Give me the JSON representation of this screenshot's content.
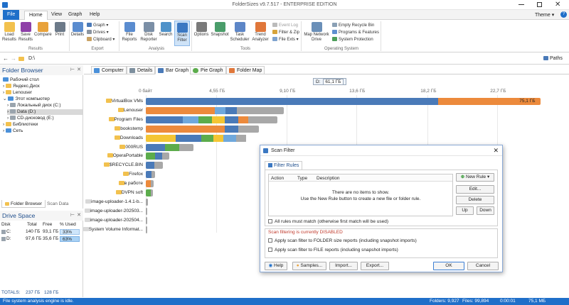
{
  "window": {
    "title": "FolderSizes v9.7.517 - ENTERPRISE EDITION",
    "theme_label": "Theme"
  },
  "ribbon_tabs": [
    "File",
    "Home",
    "View",
    "Graph",
    "Help"
  ],
  "ribbon": {
    "load": "Load Results",
    "save": "Save Results",
    "compare": "Compare",
    "print": "Print",
    "details": "Details",
    "graph": "Graph",
    "drives": "Drives",
    "clipboard": "Clipboard",
    "file_reports": "File Reports",
    "disk_reporter": "Disk Reporter",
    "search": "Search",
    "scan_filter": "Scan Filter",
    "options": "Options",
    "snapshot": "Snapshot",
    "task_scheduler": "Task Scheduler",
    "trend_analyzer": "Trend Analyzer",
    "event_log": "Event Log",
    "filter_zip": "Filter & Zip",
    "file_exts": "File Exts",
    "map_network_drive": "Map Network Drive",
    "empty_recycle_bin": "Empty Recycle Bin",
    "programs_features": "Programs & Features",
    "system_protection": "System Protection",
    "groups": {
      "results": "Results",
      "export": "Export",
      "analysis": "Analysis",
      "tools": "Tools",
      "os": "Operating System"
    }
  },
  "address": {
    "path": "D:\\",
    "paths_label": "Paths"
  },
  "folder_browser": {
    "title": "Folder Browser",
    "items": [
      "Рабочий стол",
      "Яндекс.Диск",
      "Lenouser",
      "Этот компьютер",
      "Локальный диск (C:)",
      "Data (D:)",
      "CD-дисковод (E:)",
      "Библиотеки",
      "Сеть"
    ],
    "tabs": [
      "Folder Browser",
      "Scan Data"
    ]
  },
  "drive_space": {
    "title": "Drive Space",
    "headers": [
      "Disk",
      "Total",
      "Free",
      "% Used"
    ],
    "rows": [
      [
        "C:",
        "140 ГБ",
        "93,1 ГБ",
        "33%"
      ],
      [
        "D:",
        "97,6 ГБ",
        "35,6 ГБ",
        "63%"
      ]
    ],
    "totals": [
      "TOTALS:",
      "237 ГБ",
      "128 ГБ"
    ]
  },
  "content_tabs": [
    "Computer",
    "Details",
    "Bar Graph",
    "Pie Graph",
    "Folder Map"
  ],
  "graph_header": {
    "drive": "D:",
    "size": "61,1 ГБ"
  },
  "chart_data": {
    "type": "bar",
    "orientation": "horizontal",
    "stacked": true,
    "x_ticks": [
      "0 байт",
      "4,55 ГБ",
      "9,10 ГБ",
      "13,6 ГБ",
      "18,2 ГБ",
      "22,7 ГБ"
    ],
    "xlim": [
      0,
      26.5
    ],
    "categories": [
      "VirtualBox VMs",
      "Lenouser",
      "Program Files",
      "bookstemp",
      "Downloads",
      "000RUS",
      "OperaPortable",
      "$RECYCLE.BIN",
      "Firefox",
      "в работе",
      "DVPN soft",
      "image-uploader-1.4.1-b...",
      "image-uploader-202503...",
      "image-uploader-202504...",
      "System Volume Informat..."
    ],
    "totals": [
      25.5,
      8.9,
      8.5,
      7.3,
      6.5,
      3.1,
      1.5,
      1.1,
      0.6,
      0.5,
      0.45,
      0.15,
      0.1,
      0.1,
      0.05
    ],
    "value_labels": [
      "75,1 ГБ",
      "",
      "",
      "",
      "",
      "",
      "",
      "",
      "",
      "",
      "",
      "",
      "",
      "",
      ""
    ],
    "colors": {
      "blue": "#4a7ab8",
      "orange": "#ec8a3c",
      "yellow": "#f4c534",
      "green": "#5cac4c",
      "gray": "#a8a8a8",
      "lightblue": "#6fa8dc"
    }
  },
  "dialog": {
    "title": "Scan Filter",
    "tab": "Filter Rules",
    "columns": [
      "Action",
      "Type",
      "Description"
    ],
    "empty_line1": "There are no items to show.",
    "empty_line2": "Use the New Rule button to create a new file or folder rule.",
    "buttons": {
      "new_rule": "New Rule",
      "edit": "Edit...",
      "delete": "Delete",
      "up": "Up",
      "down": "Down",
      "help": "Help",
      "samples": "Samples...",
      "import": "Import...",
      "export": "Export...",
      "ok": "OK",
      "cancel": "Cancel"
    },
    "all_rules": "All rules must match (otherwise first match will be used)",
    "disabled_msg": "Scan filtering is currently DISABLED",
    "apply_folder": "Apply scan filter to FOLDER size reports (including snapshot imports)",
    "apply_file": "Apply scan filter to FILE reports (including snapshot imports)"
  },
  "status": {
    "left": "File system analysis engine is idle.",
    "folders": "Folders: 9,927",
    "files": "Files: 99,894",
    "time": "0:00:01",
    "size": "75,1 МБ"
  }
}
